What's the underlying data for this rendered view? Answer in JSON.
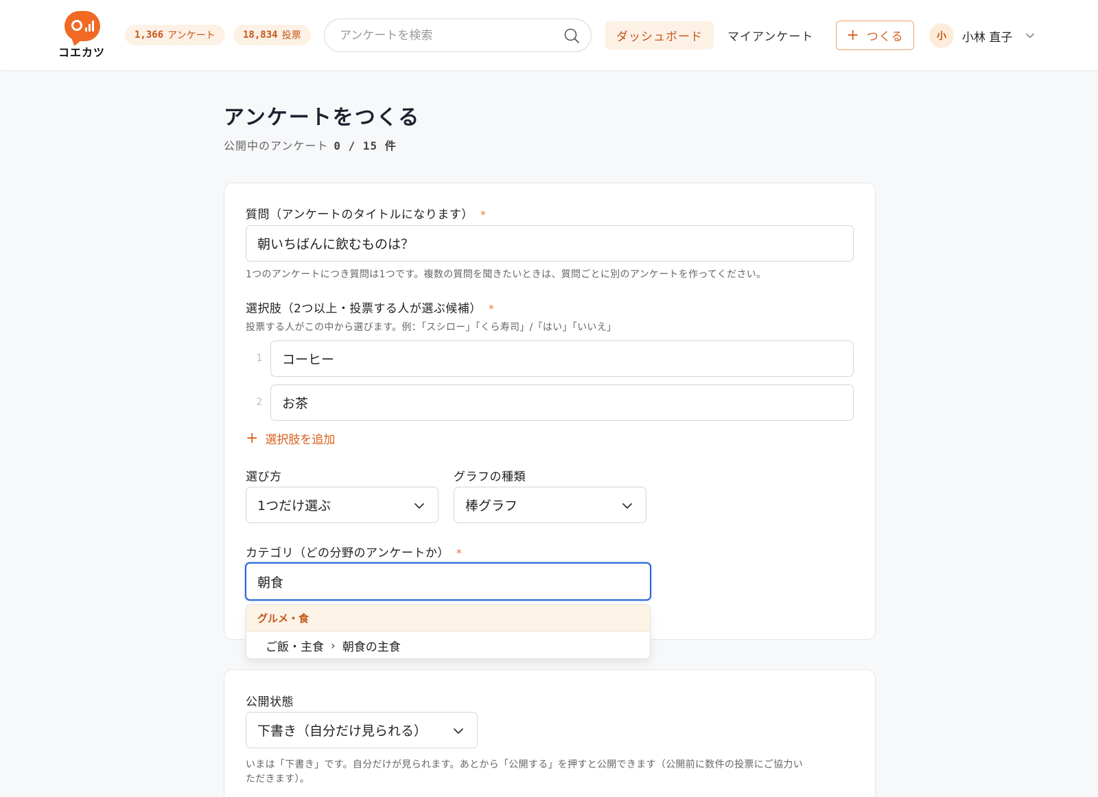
{
  "header": {
    "logo_text": "コエカツ",
    "stats": {
      "surveys_count": "1,366",
      "surveys_label": "アンケート",
      "votes_count": "18,834",
      "votes_label": "投票"
    },
    "search": {
      "placeholder": "アンケートを検索"
    },
    "nav": {
      "dashboard": "ダッシュボード",
      "my_surveys": "マイアンケート",
      "create": "つくる"
    },
    "user": {
      "avatar_initial": "小",
      "name": "小林 直子"
    }
  },
  "page": {
    "title": "アンケートをつくる",
    "published_label": "公開中のアンケート",
    "published_count": "0 / 15 件"
  },
  "form": {
    "question": {
      "label": "質問（アンケートのタイトルになります）",
      "required_mark": "*",
      "value": "朝いちばんに飲むものは？",
      "hint": "1つのアンケートにつき質問は1つです。複数の質問を聞きたいときは、質問ごとに別のアンケートを作ってください。"
    },
    "choices": {
      "label": "選択肢（2つ以上・投票する人が選ぶ候補）",
      "required_mark": "*",
      "hint": "投票する人がこの中から選びます。例：「スシロー」「くら寿司」/「はい」「いいえ」",
      "items": [
        {
          "number": "1",
          "value": "コーヒー"
        },
        {
          "number": "2",
          "value": "お茶"
        }
      ],
      "add_label": "選択肢を追加"
    },
    "selection_mode": {
      "label": "選び方",
      "value": "1つだけ選ぶ"
    },
    "chart_type": {
      "label": "グラフの種類",
      "value": "棒グラフ"
    },
    "category": {
      "label": "カテゴリ（どの分野のアンケートか）",
      "required_mark": "*",
      "value": "朝食",
      "suggestions": {
        "group": "グルメ・食",
        "item_parent": "ご飯・主食",
        "item_separator": "›",
        "item_child": "朝食の主食"
      }
    },
    "visibility": {
      "label": "公開状態",
      "value": "下書き（自分だけ見られる）",
      "hint_line1": "いまは「下書き」です。自分だけが見られます。あとから「公開する」を押すと公開できます（公開前に数件の投票にご協力い",
      "hint_line2": "ただきます）。"
    }
  },
  "colors": {
    "accent": "#d9601e",
    "accent_bg": "#fdf1e6",
    "focus": "#2563d8"
  },
  "icons": [
    "search-icon",
    "plus-icon",
    "chevron-down-icon"
  ]
}
